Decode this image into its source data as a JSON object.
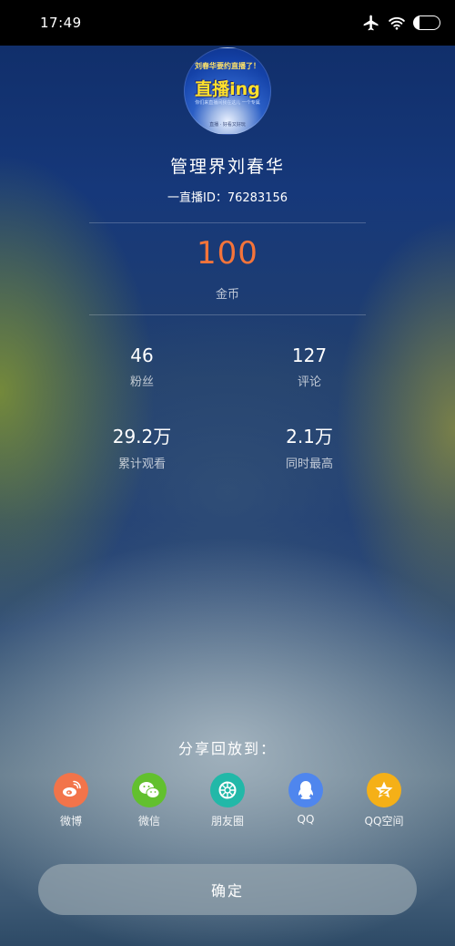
{
  "status_bar": {
    "time": "17:49",
    "battery": "21",
    "icons": [
      "airplane-icon",
      "wifi-icon",
      "battery-icon"
    ]
  },
  "profile": {
    "avatar_text": {
      "line1": "刘春华要约直播了！",
      "main": "直播ing",
      "line3": "你们来直播间我在这儿 一个专属",
      "line4": "直播 · 好看又好玩"
    },
    "name": "管理界刘春华",
    "live_id": "一直播ID：76283156"
  },
  "coins": {
    "value": "100",
    "label": "金币",
    "color": "#f5743a"
  },
  "stats": [
    {
      "value": "46",
      "label": "粉丝"
    },
    {
      "value": "127",
      "label": "评论"
    },
    {
      "value": "29.2万",
      "label": "累计观看"
    },
    {
      "value": "2.1万",
      "label": "同时最高"
    }
  ],
  "share": {
    "title": "分享回放到：",
    "items": [
      {
        "label": "微博",
        "icon": "weibo-icon",
        "color": "#f2744a"
      },
      {
        "label": "微信",
        "icon": "wechat-icon",
        "color": "#62c02e"
      },
      {
        "label": "朋友圈",
        "icon": "moments-icon",
        "color": "#22b8a8"
      },
      {
        "label": "QQ",
        "icon": "qq-icon",
        "color": "#4f86ee"
      },
      {
        "label": "QQ空间",
        "icon": "qzone-icon",
        "color": "#f5b017"
      }
    ]
  },
  "confirm_button": {
    "label": "确定"
  }
}
